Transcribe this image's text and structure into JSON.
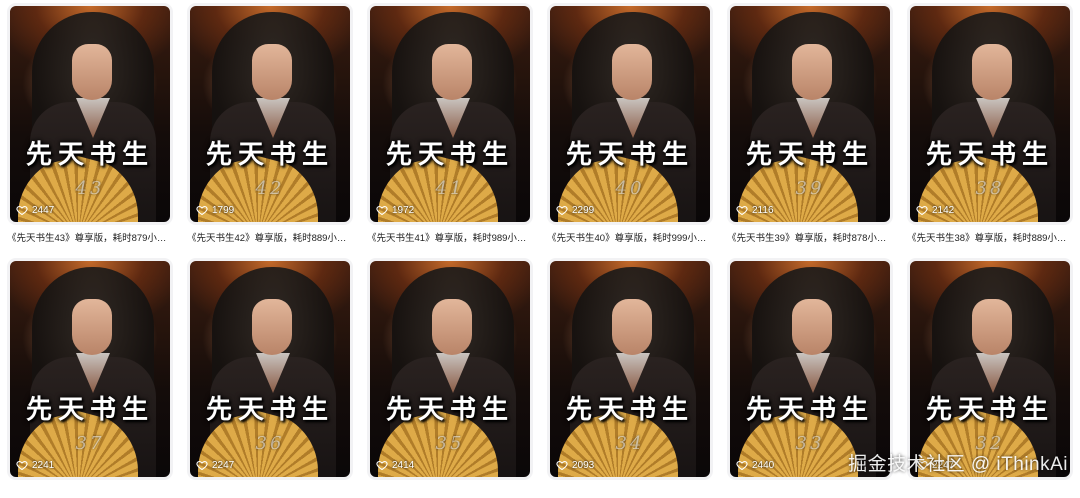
{
  "cards": [
    {
      "title_art": "先天书生",
      "episode_art": "43",
      "likes": "2447",
      "caption": "《先天书生43》尊享版，耗时879小…"
    },
    {
      "title_art": "先天书生",
      "episode_art": "42",
      "likes": "1799",
      "caption": "《先天书生42》尊享版，耗时889小…"
    },
    {
      "title_art": "先天书生",
      "episode_art": "41",
      "likes": "1972",
      "caption": "《先天书生41》尊享版，耗时989小…"
    },
    {
      "title_art": "先天书生",
      "episode_art": "40",
      "likes": "2299",
      "caption": "《先天书生40》尊享版，耗时999小…"
    },
    {
      "title_art": "先天书生",
      "episode_art": "39",
      "likes": "2116",
      "caption": "《先天书生39》尊享版，耗时878小…"
    },
    {
      "title_art": "先天书生",
      "episode_art": "38",
      "likes": "2142",
      "caption": "《先天书生38》尊享版，耗时889小…"
    },
    {
      "title_art": "先天书生",
      "episode_art": "37",
      "likes": "2241",
      "caption": ""
    },
    {
      "title_art": "先天书生",
      "episode_art": "36",
      "likes": "2247",
      "caption": ""
    },
    {
      "title_art": "先天书生",
      "episode_art": "35",
      "likes": "2414",
      "caption": ""
    },
    {
      "title_art": "先天书生",
      "episode_art": "34",
      "likes": "2093",
      "caption": ""
    },
    {
      "title_art": "先天书生",
      "episode_art": "33",
      "likes": "2440",
      "caption": ""
    },
    {
      "title_art": "先天书生",
      "episode_art": "32",
      "likes": "2247",
      "caption": ""
    }
  ],
  "icons": {
    "like": "heart-outline-icon"
  },
  "watermark": "掘金技术社区 @ iThinkAi"
}
